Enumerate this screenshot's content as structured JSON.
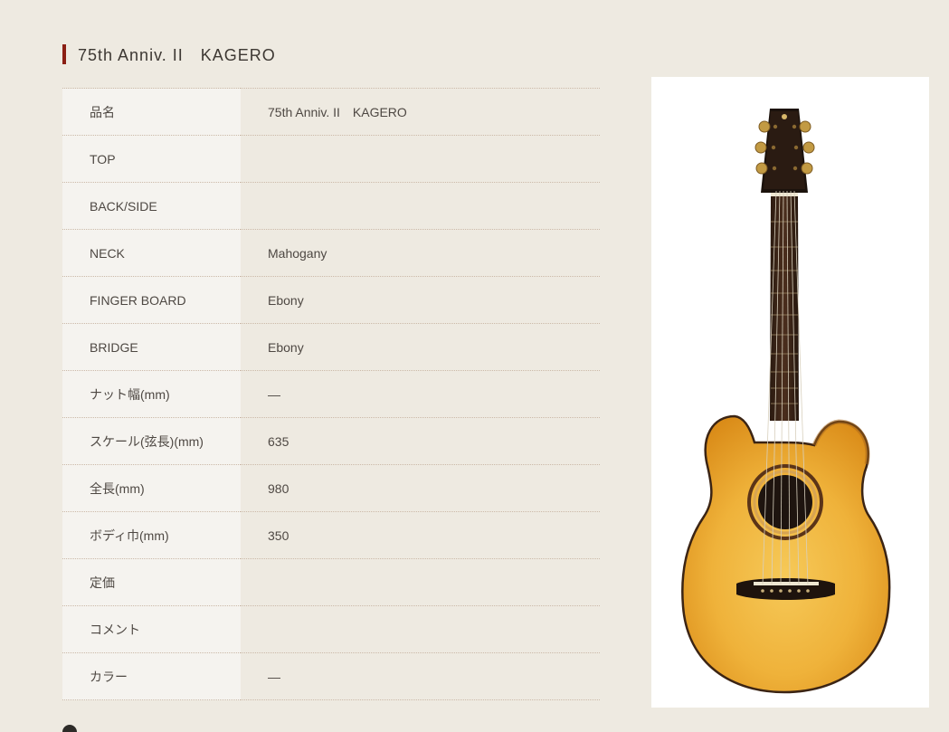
{
  "page": {
    "title": "75th Anniv. II　KAGERO"
  },
  "specs": [
    {
      "label": "品名",
      "value": "75th Anniv. II　KAGERO"
    },
    {
      "label": "TOP",
      "value": ""
    },
    {
      "label": "BACK/SIDE",
      "value": ""
    },
    {
      "label": "NECK",
      "value": "Mahogany"
    },
    {
      "label": "FINGER BOARD",
      "value": "Ebony"
    },
    {
      "label": "BRIDGE",
      "value": "Ebony"
    },
    {
      "label": "ナット幅(mm)",
      "value": "—"
    },
    {
      "label": "スケール(弦長)(mm)",
      "value": "635"
    },
    {
      "label": "全長(mm)",
      "value": "980"
    },
    {
      "label": "ボディ巾(mm)",
      "value": "350"
    },
    {
      "label": "定価",
      "value": ""
    },
    {
      "label": "コメント",
      "value": ""
    },
    {
      "label": "カラー",
      "value": "—"
    }
  ],
  "product_image": {
    "icon": "acoustic-guitar-image"
  },
  "colors": {
    "background": "#eeeae1",
    "accent": "#8b1f14",
    "label_cell": "#f5f3ef"
  }
}
